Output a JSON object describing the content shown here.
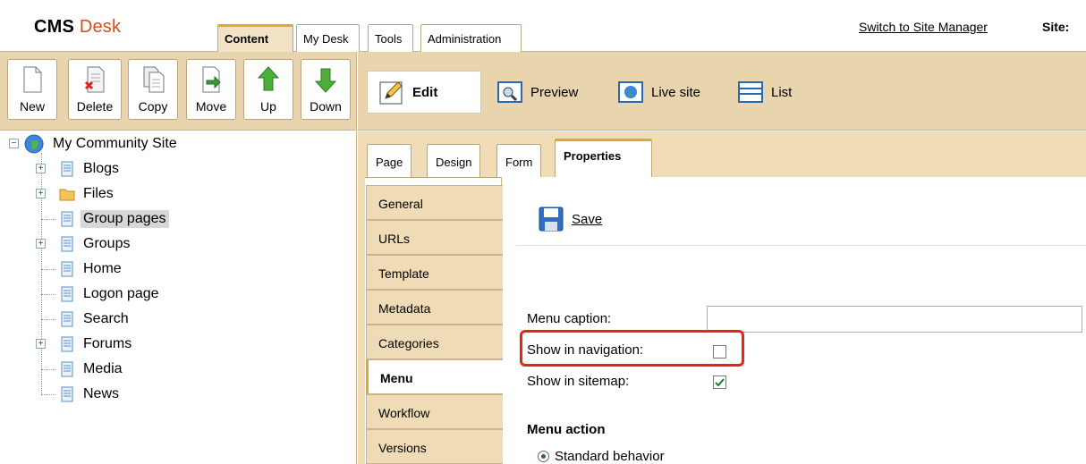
{
  "header": {
    "logo_cms": "CMS",
    "logo_desk": "Desk",
    "tabs": [
      "Content",
      "My Desk",
      "Tools",
      "Administration"
    ],
    "switch_link": "Switch to Site Manager",
    "site_label": "Site:"
  },
  "toolbar": {
    "buttons": [
      "New",
      "Delete",
      "Copy",
      "Move",
      "Up",
      "Down"
    ],
    "views": [
      "Edit",
      "Preview",
      "Live site",
      "List"
    ]
  },
  "tree": {
    "root": "My Community Site",
    "items": [
      "Blogs",
      "Files",
      "Group pages",
      "Groups",
      "Home",
      "Logon page",
      "Search",
      "Forums",
      "Media",
      "News"
    ],
    "selected": "Group pages"
  },
  "content": {
    "tabs": [
      "Page",
      "Design",
      "Form",
      "Properties"
    ],
    "active_tab": "Properties",
    "vtabs": [
      "General",
      "URLs",
      "Template",
      "Metadata",
      "Categories",
      "Menu",
      "Workflow",
      "Versions"
    ],
    "active_vtab": "Menu",
    "save_label": "Save",
    "menu_caption_label": "Menu caption:",
    "menu_caption_value": "",
    "show_in_navigation_label": "Show in navigation:",
    "show_in_navigation_checked": false,
    "show_in_sitemap_label": "Show in sitemap:",
    "show_in_sitemap_checked": true,
    "menu_action_heading": "Menu action",
    "radio_standard": "Standard behavior"
  },
  "colors": {
    "accent_orange": "#e8a52d",
    "toolbar_bg": "#e8d4ad",
    "highlight_red": "#e21"
  }
}
